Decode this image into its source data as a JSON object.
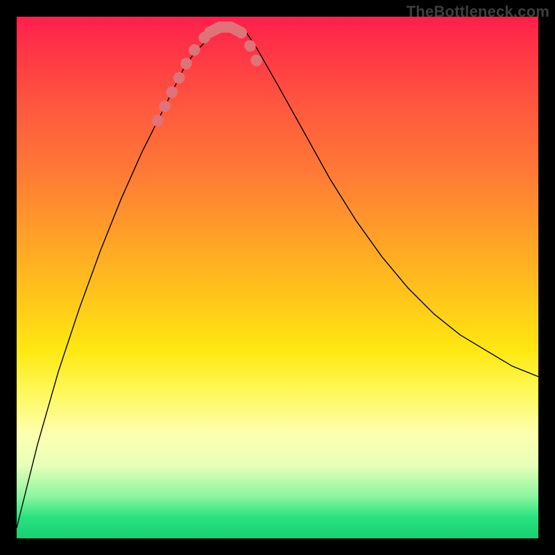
{
  "watermark": "TheBottleneck.com",
  "chart_data": {
    "type": "line",
    "title": "",
    "xlabel": "",
    "ylabel": "",
    "xlim": [
      0,
      100
    ],
    "ylim": [
      0,
      100
    ],
    "grid": false,
    "legend": false,
    "background": "rainbow_vertical_red_to_green",
    "series": [
      {
        "name": "bottleneck-curve",
        "x": [
          0,
          4,
          8,
          12,
          16,
          20,
          24,
          28,
          30,
          32,
          34,
          36,
          38,
          40,
          42,
          44,
          46,
          50,
          55,
          60,
          65,
          70,
          75,
          80,
          85,
          90,
          95,
          100
        ],
        "y": [
          2,
          18,
          32,
          44,
          55,
          65,
          74,
          82,
          86,
          90,
          93,
          95,
          97,
          98,
          98,
          97,
          94,
          87,
          78,
          69,
          61,
          54,
          48,
          43,
          39,
          36,
          33,
          31
        ]
      }
    ],
    "highlight": {
      "name": "optimal-range-markers",
      "color": "#e0727a",
      "style": "dotted-thick",
      "points_x": [
        27,
        29,
        31,
        33,
        35,
        37,
        39,
        41,
        43,
        45,
        47
      ],
      "points_y": [
        80,
        84,
        88,
        92,
        95,
        97,
        98,
        98,
        97,
        94,
        89
      ]
    }
  }
}
